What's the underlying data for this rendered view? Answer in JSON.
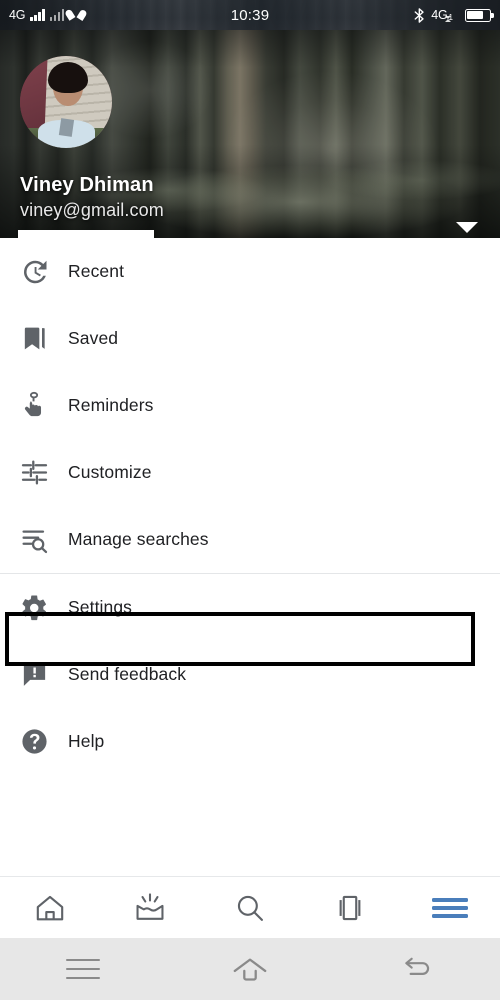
{
  "status_bar": {
    "network_label": "4G",
    "time": "10:39",
    "network_right_label": "4G",
    "network_right_sub": "1",
    "icons": [
      "signal-bars-sim1",
      "signal-bars-sim2",
      "heart-icon",
      "bluetooth-icon",
      "mobile-data-arrows",
      "battery-icon"
    ],
    "battery_level_percent": 72
  },
  "header": {
    "name": "Viney Dhiman",
    "email": "viney@gmail.com",
    "email_visible_suffix": "@gmail.com",
    "email_redacted": true,
    "avatar_name": "profile-avatar",
    "dropdown_icon": "chevron-down-icon",
    "background_image": "forest-photo"
  },
  "menu": {
    "items": [
      {
        "label": "Recent",
        "icon": "history-clock-icon",
        "name": "menu-item-recent"
      },
      {
        "label": "Saved",
        "icon": "bookmark-icon",
        "name": "menu-item-saved"
      },
      {
        "label": "Reminders",
        "icon": "finger-string-icon",
        "name": "menu-item-reminders"
      },
      {
        "label": "Customize",
        "icon": "sliders-icon",
        "name": "menu-item-customize"
      },
      {
        "label": "Manage searches",
        "icon": "list-search-icon",
        "name": "menu-item-manage-searches"
      }
    ],
    "group2": [
      {
        "label": "Settings",
        "icon": "gear-icon",
        "name": "menu-item-settings",
        "selected": true
      },
      {
        "label": "Send feedback",
        "icon": "feedback-bubble-icon",
        "name": "menu-item-send-feedback",
        "selected": false
      },
      {
        "label": "Help",
        "icon": "help-circle-icon",
        "name": "menu-item-help",
        "selected": false
      }
    ]
  },
  "bottom_nav": {
    "items": [
      {
        "icon": "home-icon",
        "name": "bottom-nav-home",
        "active": false
      },
      {
        "icon": "inbox-rays-icon",
        "name": "bottom-nav-updates",
        "active": false
      },
      {
        "icon": "search-icon",
        "name": "bottom-nav-search",
        "active": false
      },
      {
        "icon": "cards-stack-icon",
        "name": "bottom-nav-collections",
        "active": false
      },
      {
        "icon": "hamburger-icon",
        "name": "bottom-nav-more",
        "active": true
      }
    ],
    "active_color": "#4a7ebb"
  },
  "system_nav": {
    "items": [
      {
        "icon": "recents-menu-icon",
        "name": "system-nav-recents"
      },
      {
        "icon": "home-outline-icon",
        "name": "system-nav-home"
      },
      {
        "icon": "back-arrow-icon",
        "name": "system-nav-back"
      }
    ]
  },
  "colors": {
    "icon_gray": "#5f6368",
    "text_primary": "#202124",
    "divider": "#e4e6e8",
    "selection_outline": "#000000",
    "system_nav_bg": "#e7e7e7"
  }
}
